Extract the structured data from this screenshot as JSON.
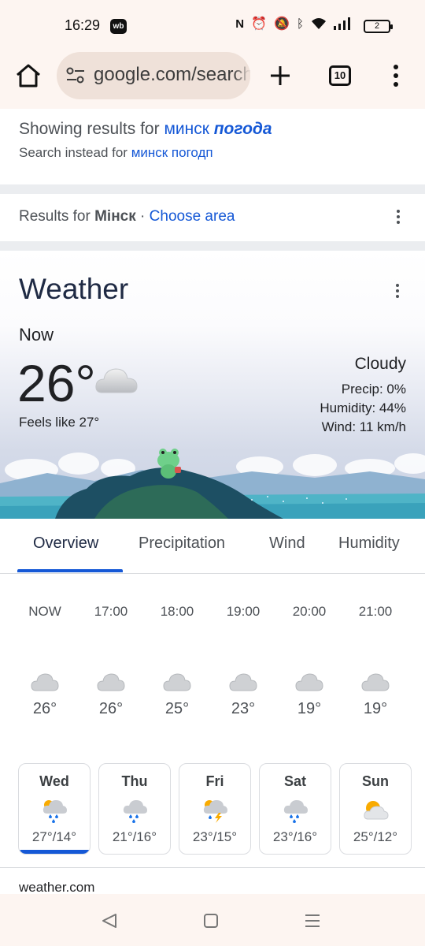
{
  "status_bar": {
    "time": "16:29",
    "app_badge": "wb",
    "battery": "2"
  },
  "browser": {
    "url": "google.com/search",
    "tab_count": "10"
  },
  "spelling": {
    "showing_prefix": "Showing results for",
    "showing_query_plain": "минск",
    "showing_query_bold": "погода",
    "instead_prefix": "Search instead for",
    "instead_query": "минск погодп"
  },
  "location": {
    "prefix": "Results for",
    "city": "Мінск",
    "separator": "·",
    "choose_area": "Choose area"
  },
  "weather": {
    "title": "Weather",
    "now_label": "Now",
    "temperature": "26°",
    "feels_like": "Feels like 27°",
    "condition": "Cloudy",
    "precip": "Precip: 0%",
    "humidity": "Humidity: 44%",
    "wind": "Wind: 11 km/h",
    "tabs": [
      "Overview",
      "Precipitation",
      "Wind",
      "Humidity"
    ],
    "active_tab": "Overview",
    "hourly": [
      {
        "time": "NOW",
        "temp": "26°",
        "icon": "cloud-icon"
      },
      {
        "time": "17:00",
        "temp": "26°",
        "icon": "cloud-icon"
      },
      {
        "time": "18:00",
        "temp": "25°",
        "icon": "cloud-icon"
      },
      {
        "time": "19:00",
        "temp": "23°",
        "icon": "cloud-icon"
      },
      {
        "time": "20:00",
        "temp": "19°",
        "icon": "cloud-icon"
      },
      {
        "time": "21:00",
        "temp": "19°",
        "icon": "cloud-icon"
      }
    ],
    "daily": [
      {
        "day": "Wed",
        "range": "27°/14°",
        "icon": "rain-showers-icon",
        "selected": true
      },
      {
        "day": "Thu",
        "range": "21°/16°",
        "icon": "rain-showers-icon",
        "selected": false
      },
      {
        "day": "Fri",
        "range": "23°/15°",
        "icon": "thunderstorm-icon",
        "selected": false
      },
      {
        "day": "Sat",
        "range": "23°/16°",
        "icon": "rain-showers-icon",
        "selected": false
      },
      {
        "day": "Sun",
        "range": "25°/12°",
        "icon": "partly-cloudy-icon",
        "selected": false
      }
    ],
    "source": "weather.com"
  },
  "colors": {
    "link_blue": "#1558d6",
    "chrome_bg": "#fdf5f1",
    "url_pill": "#efe1d9",
    "rain_blue": "#1a73e8",
    "sun_yellow": "#f9ab00"
  }
}
